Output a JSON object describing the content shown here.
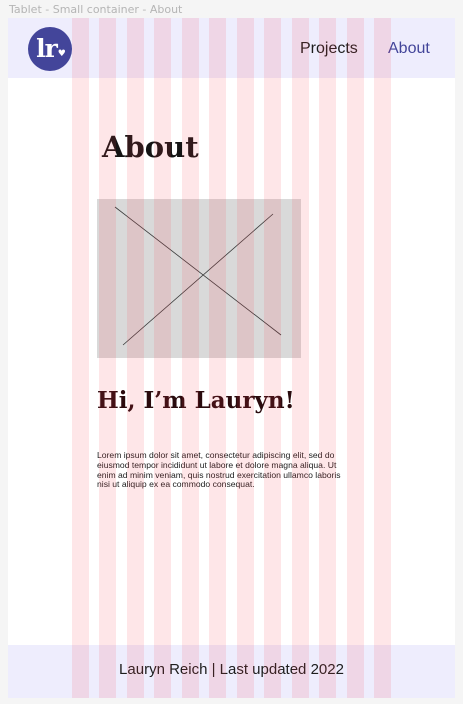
{
  "canvas": {
    "frame_label": "Tablet - Small container - About"
  },
  "header": {
    "logo_text": "lr",
    "logo_heart": "♥",
    "nav": [
      {
        "label": "Projects",
        "active": false
      },
      {
        "label": "About",
        "active": true
      }
    ]
  },
  "main": {
    "title": "About",
    "greeting": "Hi, I’m Lauryn!",
    "body": "Lorem ipsum dolor sit amet, consectetur adipiscing elit, sed do eiusmod tempor incididunt ut labore et dolore magna aliqua. Ut enim ad minim veniam, quis nostrud exercitation ullamco laboris nisi ut aliquip ex ea commodo consequat."
  },
  "footer": {
    "text": "Lauryn Reich | Last updated 2022"
  },
  "colors": {
    "brand": "#43459a",
    "header_bg": "#eeedfd",
    "grid_overlay": "#f73c50",
    "placeholder": "#d9d9d9"
  }
}
